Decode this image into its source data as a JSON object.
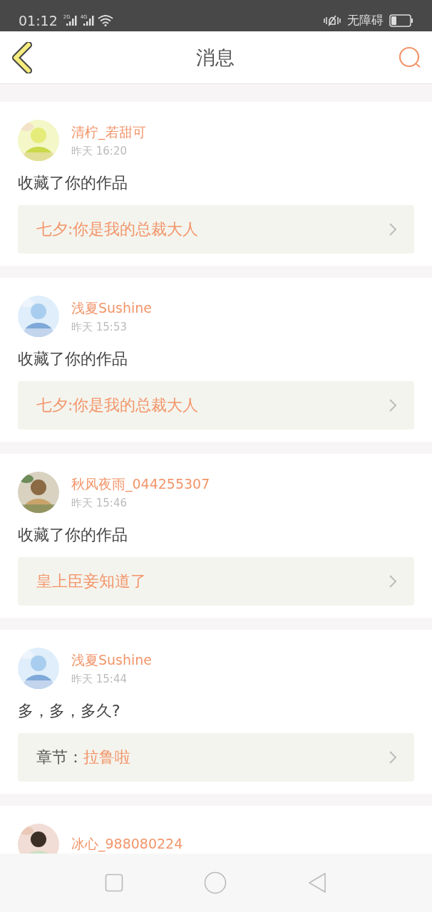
{
  "status_bar": {
    "time": "01:12",
    "networks": [
      "2G",
      "4G"
    ],
    "accessibility": "无障碍"
  },
  "header": {
    "title": "消息"
  },
  "messages": [
    {
      "name": "清柠_若甜可",
      "time": "昨天 16:20",
      "text": "收藏了你的作品",
      "link": {
        "kind": "work",
        "title": "七夕:你是我的总裁大人"
      }
    },
    {
      "name": "浅夏Sushine",
      "time": "昨天 15:53",
      "text": "收藏了你的作品",
      "link": {
        "kind": "work",
        "title": "七夕:你是我的总裁大人"
      }
    },
    {
      "name": "秋风夜雨_044255307",
      "time": "昨天 15:46",
      "text": "收藏了你的作品",
      "link": {
        "kind": "work",
        "title": "皇上臣妾知道了"
      }
    },
    {
      "name": "浅夏Sushine",
      "time": "昨天 15:44",
      "text": "多，多，多久?",
      "link": {
        "kind": "chapter",
        "label": "章节：",
        "title": "拉鲁啦"
      }
    },
    {
      "name": "冰心_988080224"
    }
  ]
}
